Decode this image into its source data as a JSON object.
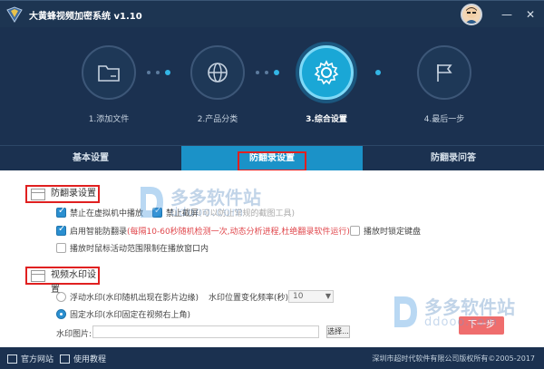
{
  "app": {
    "title": "大黄蜂视频加密系统 v1.10",
    "minimize": "—",
    "close": "✕"
  },
  "steps": [
    {
      "label": "1.添加文件",
      "icon": "folder-icon",
      "active": false
    },
    {
      "label": "2.产品分类",
      "icon": "globe-icon",
      "active": false
    },
    {
      "label": "3.综合设置",
      "icon": "gear-icon",
      "active": true
    },
    {
      "label": "4.最后一步",
      "icon": "flag-icon",
      "active": false
    }
  ],
  "tabs": [
    {
      "label": "基本设置",
      "active": false
    },
    {
      "label": "防翻录设置",
      "active": true
    },
    {
      "label": "防翻录问答",
      "active": false
    }
  ],
  "anti_record": {
    "section_title": "防翻录设置",
    "opt_vm": {
      "label": "禁止在虚拟机中播放",
      "checked": true
    },
    "opt_screenshot": {
      "label": "禁止截屏",
      "hint": "(可以防止常规的截图工具)",
      "checked": true
    },
    "opt_smart": {
      "label": "启用智能防翻录",
      "note": "(每隔10-60秒随机检测一次,动态分析进程,杜绝翻录软件运行)",
      "checked": true
    },
    "opt_lockkb": {
      "label": "播放时锁定键盘",
      "checked": false
    },
    "opt_mouse": {
      "label": "播放时鼠标活动范围限制在播放窗口内",
      "checked": false
    }
  },
  "watermark": {
    "section_title": "视频水印设置",
    "opt_float": {
      "label": "浮动水印(水印随机出现在影片边缘)",
      "selected": false
    },
    "freq_label": "水印位置变化频率(秒):",
    "freq_value": "10",
    "opt_fixed": {
      "label": "固定水印(水印固定在视频右上角)",
      "selected": true
    },
    "image_label": "水印图片:",
    "image_value": "",
    "browse_label": "选择..."
  },
  "next_button": "下一步",
  "site_watermark": {
    "name": "多多软件站",
    "domain": "ddooo.com"
  },
  "footer": {
    "website": "官方网站",
    "tutorial": "使用教程",
    "copyright": "深圳市超时代软件有限公司版权所有©2005-2017"
  },
  "colors": {
    "header_bg": "#1b3150",
    "accent": "#1b92c8",
    "highlight": "#e02020",
    "checkbox": "#2a8fd0",
    "next_button": "#ef6d6d"
  }
}
